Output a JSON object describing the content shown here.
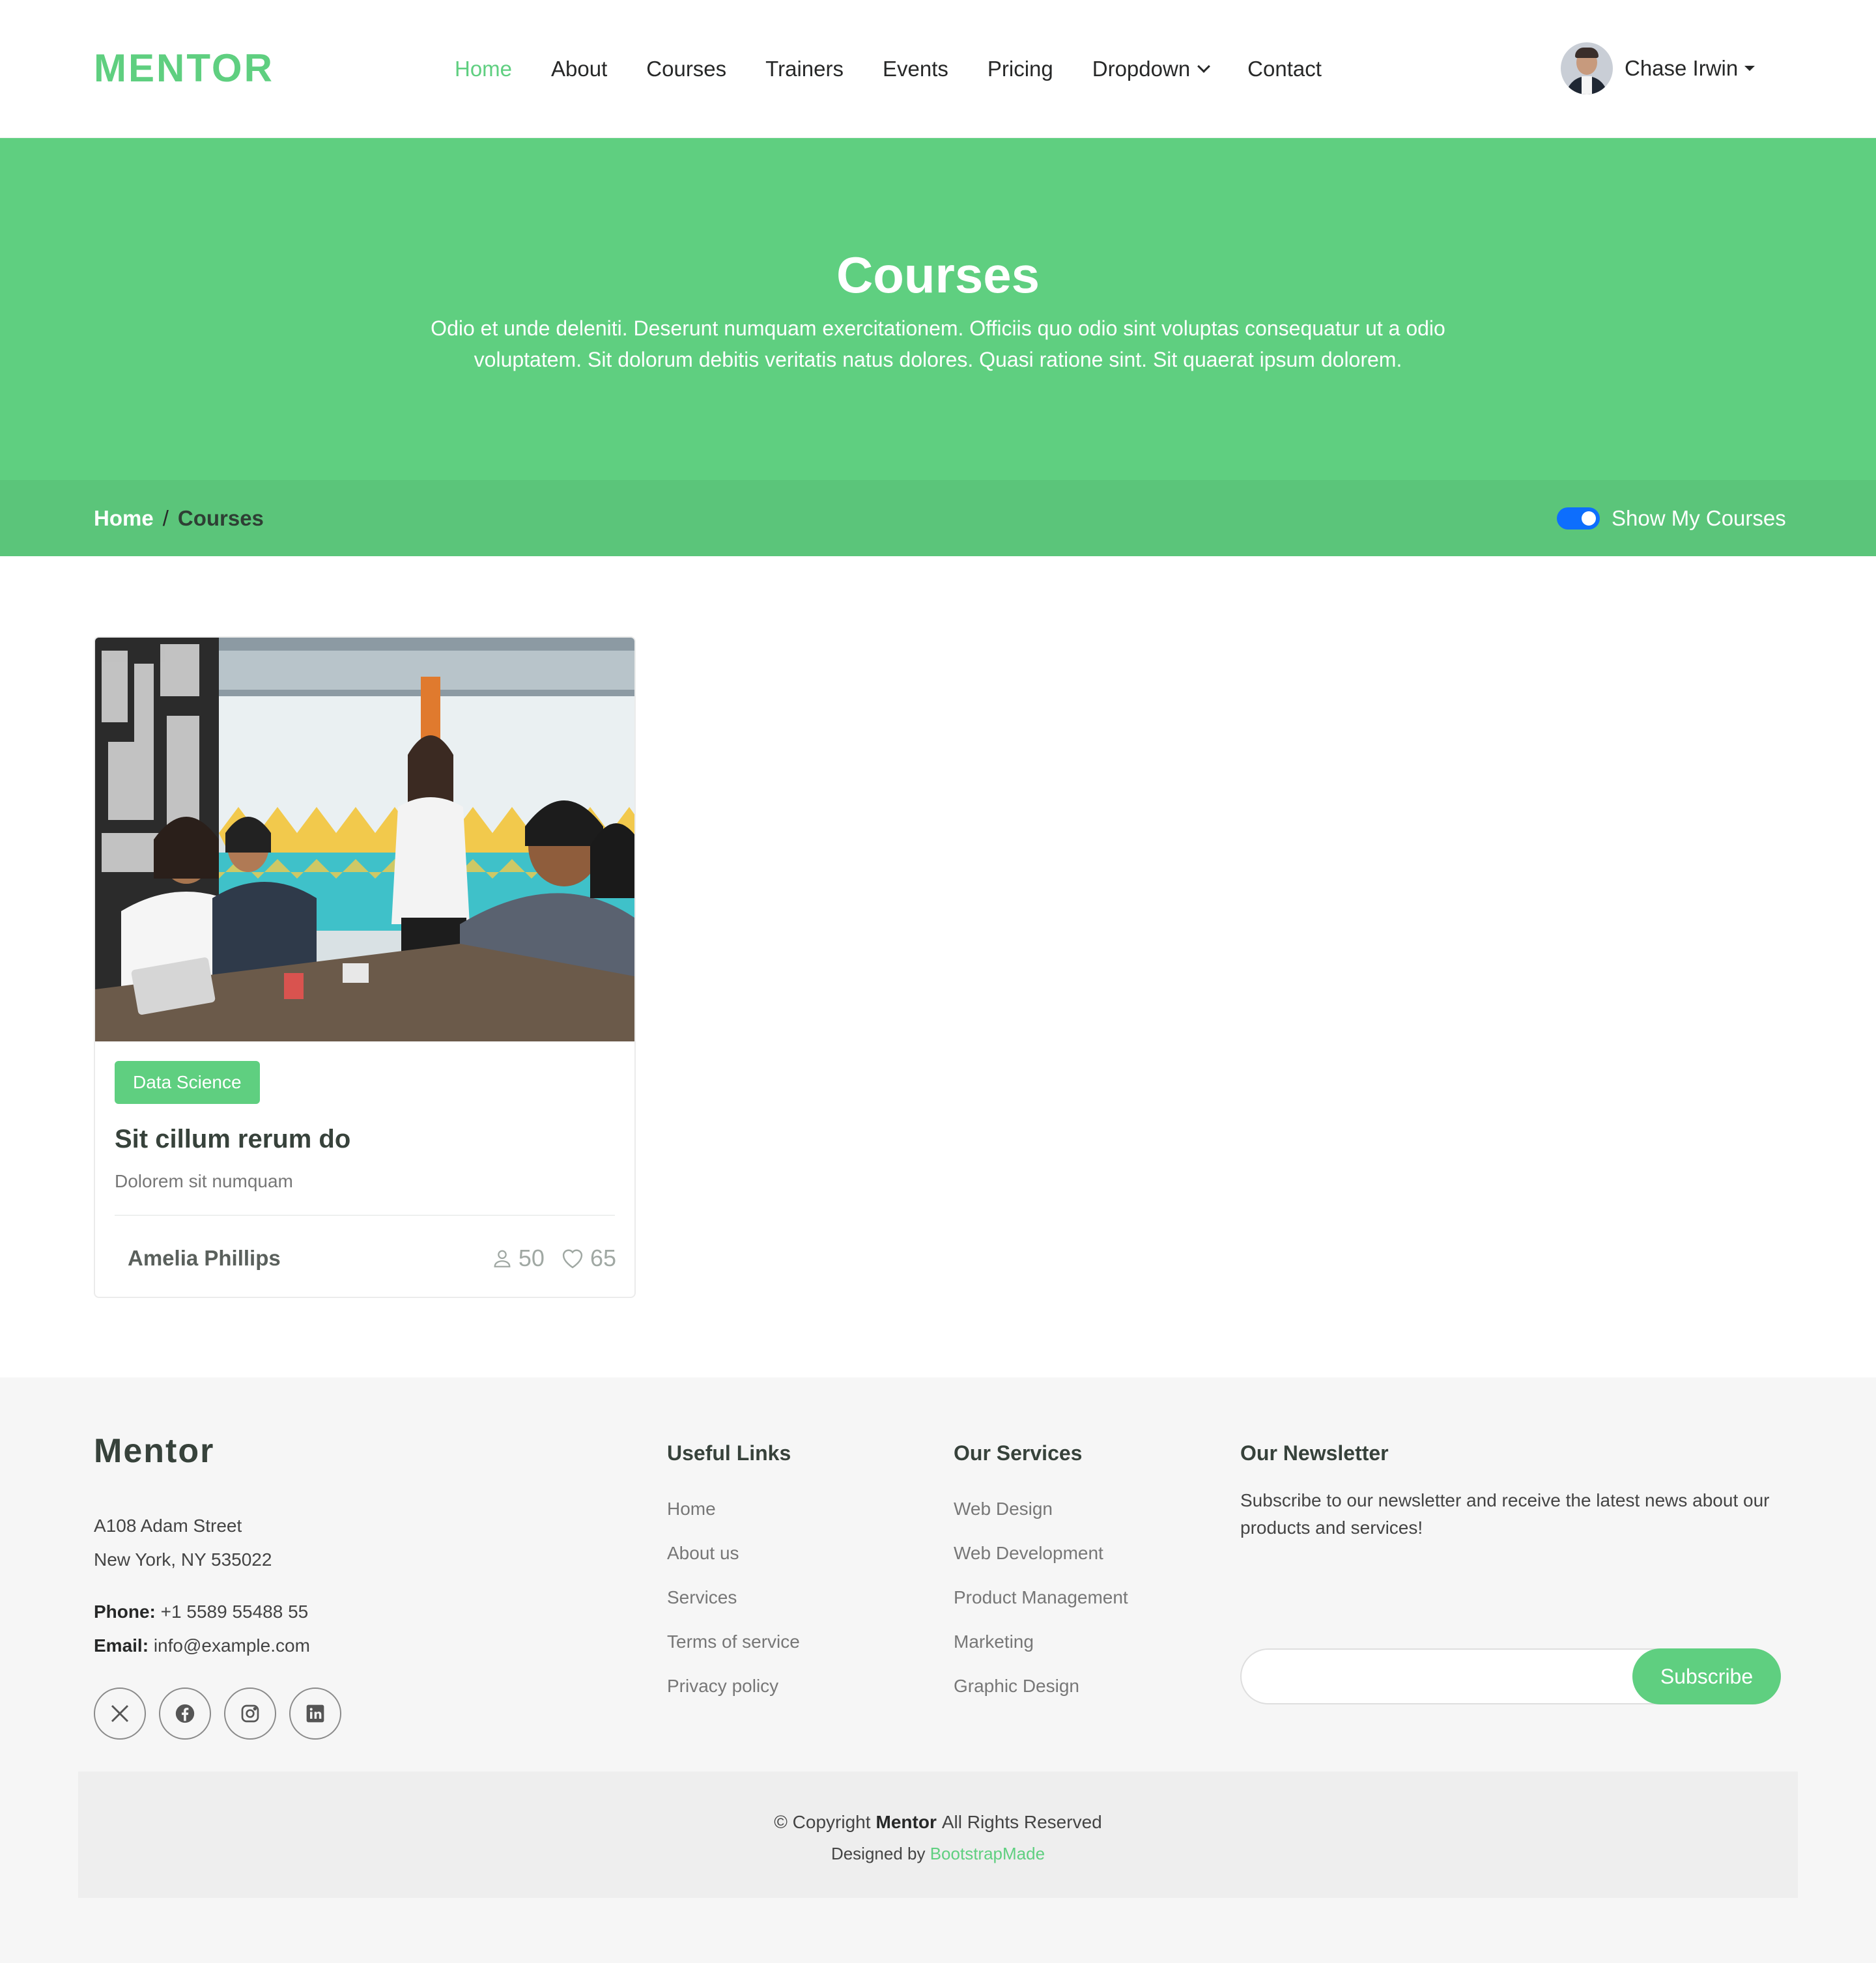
{
  "brand": {
    "logo": "MENTOR",
    "accent_color": "#5fcf80"
  },
  "nav": {
    "items": [
      {
        "label": "Home",
        "active": true
      },
      {
        "label": "About"
      },
      {
        "label": "Courses"
      },
      {
        "label": "Trainers"
      },
      {
        "label": "Events"
      },
      {
        "label": "Pricing"
      },
      {
        "label": "Dropdown",
        "icon": "chevron-down-icon"
      },
      {
        "label": "Contact"
      }
    ]
  },
  "user": {
    "name": "Chase Irwin",
    "icon": "caret-down-icon"
  },
  "page_title": {
    "heading": "Courses",
    "description": "Odio et unde deleniti. Deserunt numquam exercitationem. Officiis quo odio sint voluptas consequatur ut a odio voluptatem. Sit dolorum debitis veritatis natus dolores. Quasi ratione sint. Sit quaerat ipsum dolorem."
  },
  "breadcrumbs": {
    "home": "Home",
    "separator": "/",
    "current": "Courses"
  },
  "filter": {
    "label": "Show My Courses",
    "enabled": true
  },
  "courses": [
    {
      "category": "Data Science",
      "title": "Sit cillum rerum do",
      "subtitle": "Dolorem sit numquam",
      "trainer": "Amelia Phillips",
      "students": "50",
      "likes": "65"
    }
  ],
  "footer": {
    "brand": "Mentor",
    "address_line1": "A108 Adam Street",
    "address_line2": "New York, NY 535022",
    "phone_label": "Phone:",
    "phone": "+1 5589 55488 55",
    "email_label": "Email:",
    "email": "info@example.com",
    "socials": [
      "x-icon",
      "facebook-icon",
      "instagram-icon",
      "linkedin-icon"
    ],
    "useful_links": {
      "title": "Useful Links",
      "items": [
        "Home",
        "About us",
        "Services",
        "Terms of service",
        "Privacy policy"
      ]
    },
    "services": {
      "title": "Our Services",
      "items": [
        "Web Design",
        "Web Development",
        "Product Management",
        "Marketing",
        "Graphic Design"
      ]
    },
    "newsletter": {
      "title": "Our Newsletter",
      "text": "Subscribe to our newsletter and receive the latest news about our products and services!",
      "button": "Subscribe",
      "placeholder": ""
    },
    "copyright_prefix": "© Copyright",
    "copyright_brand": "Mentor",
    "copyright_suffix": "All Rights Reserved",
    "designed_by": "Designed by",
    "designer": "BootstrapMade"
  }
}
